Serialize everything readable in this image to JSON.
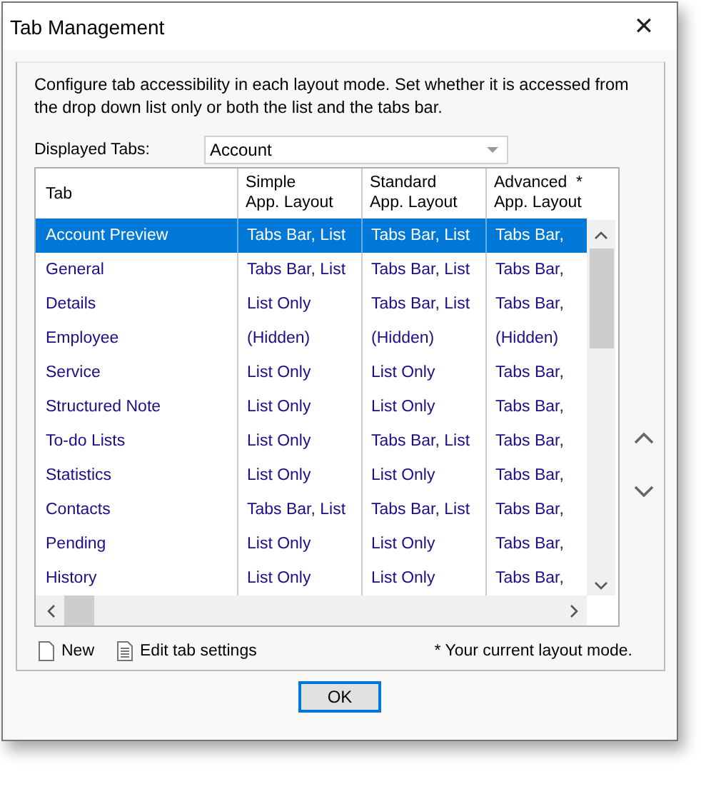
{
  "window": {
    "title": "Tab Management",
    "close": "✕"
  },
  "description": "Configure tab accessibility in each layout mode. Set whether it is accessed from the drop down list only or both the list and the tabs bar.",
  "displayed_tabs": {
    "label": "Displayed Tabs:",
    "value": "Account"
  },
  "table": {
    "columns": [
      "Tab",
      "Simple\nApp. Layout",
      "Standard\nApp. Layout",
      "Advanced  *\nApp. Layout"
    ],
    "rows": [
      {
        "tab": "Account Preview",
        "simple": "Tabs Bar, List",
        "standard": "Tabs Bar, List",
        "advanced": "Tabs Bar,",
        "selected": true
      },
      {
        "tab": "General",
        "simple": "Tabs Bar, List",
        "standard": "Tabs Bar, List",
        "advanced": "Tabs Bar,",
        "selected": false
      },
      {
        "tab": "Details",
        "simple": "List Only",
        "standard": "Tabs Bar, List",
        "advanced": "Tabs Bar,",
        "selected": false
      },
      {
        "tab": "Employee",
        "simple": "(Hidden)",
        "standard": "(Hidden)",
        "advanced": "(Hidden)",
        "selected": false
      },
      {
        "tab": "Service",
        "simple": "List Only",
        "standard": "List Only",
        "advanced": "Tabs Bar,",
        "selected": false
      },
      {
        "tab": "Structured Note",
        "simple": "List Only",
        "standard": "List Only",
        "advanced": "Tabs Bar,",
        "selected": false
      },
      {
        "tab": "To-do Lists",
        "simple": "List Only",
        "standard": "Tabs Bar, List",
        "advanced": "Tabs Bar,",
        "selected": false
      },
      {
        "tab": "Statistics",
        "simple": "List Only",
        "standard": "List Only",
        "advanced": "Tabs Bar,",
        "selected": false
      },
      {
        "tab": "Contacts",
        "simple": "Tabs Bar, List",
        "standard": "Tabs Bar, List",
        "advanced": "Tabs Bar,",
        "selected": false
      },
      {
        "tab": "Pending",
        "simple": "List Only",
        "standard": "List Only",
        "advanced": "Tabs Bar,",
        "selected": false
      },
      {
        "tab": "History",
        "simple": "List Only",
        "standard": "List Only",
        "advanced": "Tabs Bar,",
        "selected": false
      }
    ]
  },
  "actions": [
    {
      "kind": "new",
      "label": "New"
    },
    {
      "kind": "edit",
      "label": "Edit tab settings"
    }
  ],
  "footnote": "* Your current layout mode.",
  "ok_button": "OK"
}
